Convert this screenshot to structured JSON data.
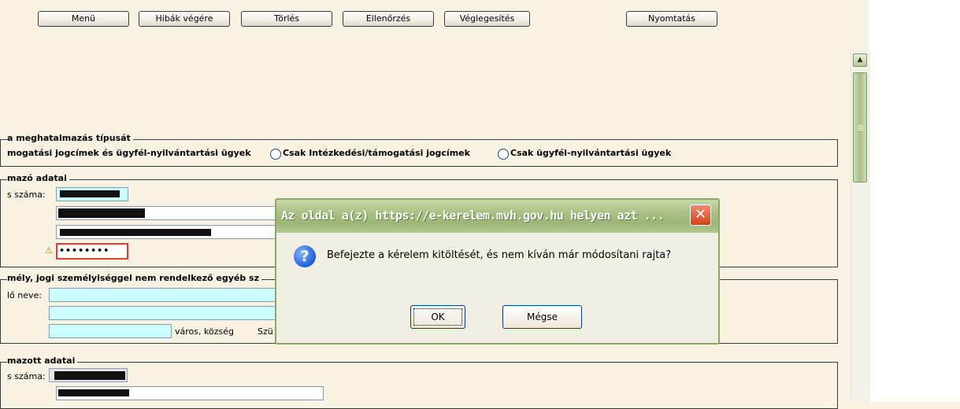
{
  "toolbar": {
    "menu": "Menü",
    "errors_end": "Hibák végére",
    "delete": "Törlés",
    "check": "Ellenőrzés",
    "finalize": "Véglegesítés",
    "print": "Nyomtatás"
  },
  "section_type": {
    "legend": "a meghatalmazás típusát",
    "option_all": "mogatási jogcímek és ügyfél-nyilvántartási ügyek",
    "option_measures": "Csak Intézkedési/támogatási jogcímek",
    "option_client": "Csak ügyfél-nyilvántartási ügyek"
  },
  "section_principal": {
    "legend": "mazó adatai",
    "number_label": "s száma:",
    "password_value": "••••••••"
  },
  "section_org": {
    "legend": "mély, jogi személyiséggel nem rendelkező egyéb sz",
    "name_label": "lő neve:",
    "city_label": "város, község",
    "street_label": "Szü"
  },
  "section_agent": {
    "legend": "mazott adatai",
    "number_label": "s száma:"
  },
  "dialog": {
    "title": "Az oldal a(z) https://e-kerelem.mvh.gov.hu helyen azt ...",
    "message": "Befejezte a kérelem kitöltését, és nem kíván már módosítani rajta?",
    "ok": "OK",
    "cancel": "Mégse",
    "close_symbol": "✕",
    "question_symbol": "?"
  },
  "icons": {
    "warning_symbol": "⚠",
    "scroll_up_symbol": "▲"
  }
}
